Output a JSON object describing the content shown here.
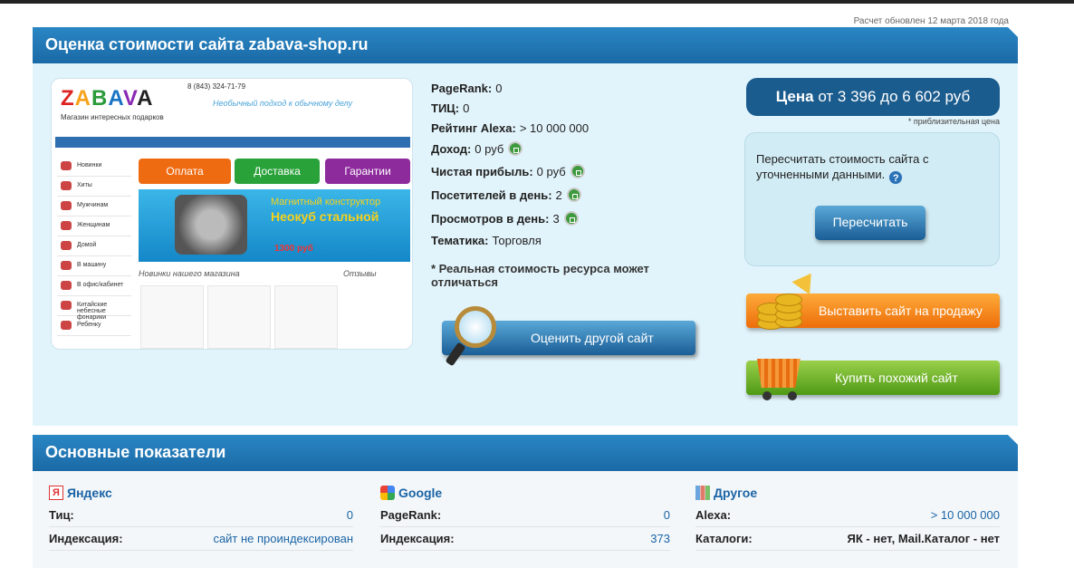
{
  "header": {
    "updated": "Расчет обновлен 12 марта 2018 года",
    "title": "Оценка стоимости сайта zabava-shop.ru"
  },
  "thumbnail": {
    "logo_letters": [
      "Z",
      "A",
      "B",
      "A",
      "V",
      "A"
    ],
    "slogan": "Магазин интересных подарков",
    "phone": "8 (843) 324-71-79",
    "tagline": "Необычный подход к обычному делу",
    "buttons": [
      "Оплата",
      "Доставка",
      "Гарантии"
    ],
    "side_items": [
      "Новинки",
      "Хиты",
      "Мужчинам",
      "Женщинам",
      "Домой",
      "В машину",
      "В офис/кабинет",
      "Китайские небесные фонарики",
      "Ребенку"
    ],
    "banner_title": "Магнитный конструктор",
    "banner_sub": "Неокуб стальной",
    "banner_price": "1300 руб",
    "new_label": "Новинки нашего магазина",
    "reviews_label": "Отзывы"
  },
  "stats": {
    "pagerank_label": "PageRank:",
    "pagerank_value": "0",
    "tic_label": "ТИЦ:",
    "tic_value": "0",
    "alexa_label": "Рейтинг Alexa:",
    "alexa_value": "> 10 000 000",
    "income_label": "Доход:",
    "income_value": "0 руб",
    "profit_label": "Чистая прибыль:",
    "profit_value": "0 руб",
    "visitors_label": "Посетителей в день:",
    "visitors_value": "2",
    "views_label": "Просмотров в день:",
    "views_value": "3",
    "topic_label": "Тематика:",
    "topic_value": "Торговля"
  },
  "note": "* Реальная стоимость ресурса может отличаться",
  "eval_button": "Оценить другой сайт",
  "price": {
    "label": "Цена",
    "value": "от 3 396 до 6 602 руб",
    "approx": "* приблизительная цена"
  },
  "recalc": {
    "text": "Пересчитать стоимость сайта с уточненными данными.",
    "help": "?",
    "button": "Пересчитать"
  },
  "sell_button": "Выставить сайт на продажу",
  "buy_button": "Купить похожий сайт",
  "section2": {
    "title": "Основные показатели",
    "yandex": {
      "title": "Яндекс",
      "tic_label": "Тиц:",
      "tic_value": "0",
      "index_label": "Индексация:",
      "index_value": "сайт не проиндексирован"
    },
    "google": {
      "title": "Google",
      "pr_label": "PageRank:",
      "pr_value": "0",
      "index_label": "Индексация:",
      "index_value": "373"
    },
    "other": {
      "title": "Другое",
      "alexa_label": "Alexa:",
      "alexa_value": "> 10 000 000",
      "catalogs_label": "Каталоги:",
      "catalogs_value": "ЯК - нет, Mail.Каталог - нет"
    }
  },
  "colors": {
    "header_blue": "#1a6aa6",
    "panel_bg": "#e2f4fb",
    "price_bg": "#1b5c8e",
    "sell_orange": "#ee6d0a",
    "buy_green": "#4f9a16",
    "link_blue": "#1a64a6"
  }
}
